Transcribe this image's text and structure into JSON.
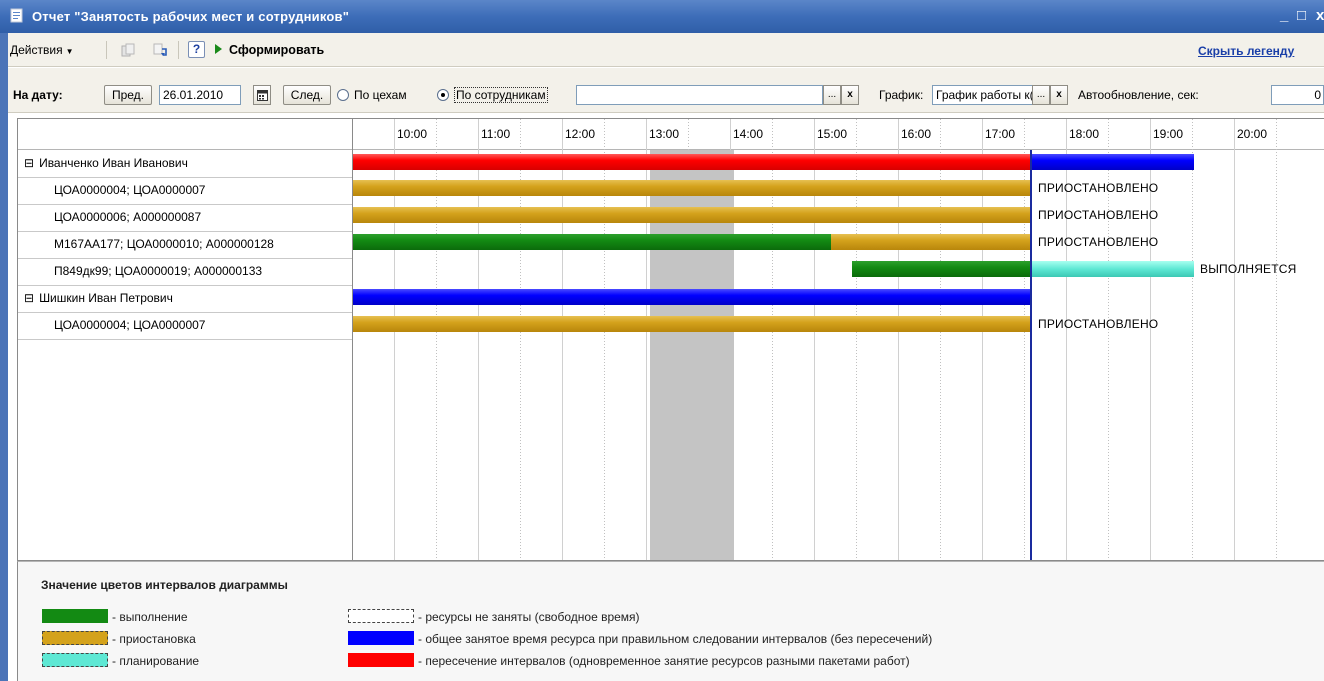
{
  "window": {
    "title": "Отчет  \"Занятость рабочих мест и сотрудников\"",
    "minimize": "_",
    "maximize": "□",
    "close": "x"
  },
  "toolbar": {
    "actions_label": "Действия",
    "help_label": "?",
    "run_label": "Сформировать",
    "hide_legend_label": "Скрыть легенду"
  },
  "filter": {
    "date_label": "На дату:",
    "prev_label": "Пред.",
    "date_value": "26.01.2010",
    "next_label": "След.",
    "radio_shops": "По цехам",
    "radio_employees": "По сотрудникам",
    "employee_value": "",
    "ellipsis": "...",
    "clear": "x",
    "schedule_label": "График:",
    "schedule_value": "График работы к(",
    "autorefresh_label": "Автообновление, сек:",
    "autorefresh_value": "0"
  },
  "timeline": {
    "hours": [
      "10:00",
      "11:00",
      "12:00",
      "13:00",
      "14:00",
      "15:00",
      "16:00",
      "17:00",
      "18:00",
      "19:00",
      "20:00"
    ]
  },
  "rows": [
    {
      "label": "Иванченко Иван Иванович",
      "group": true,
      "status": ""
    },
    {
      "label": "ЦОА0000004; ЦОА0000007",
      "group": false,
      "status": "ПРИОСТАНОВЛЕНО"
    },
    {
      "label": "ЦОА0000006; А000000087",
      "group": false,
      "status": "ПРИОСТАНОВЛЕНО"
    },
    {
      "label": "М167АА177; ЦОА0000010; А000000128",
      "group": false,
      "status": "ПРИОСТАНОВЛЕНО"
    },
    {
      "label": "П849дк99; ЦОА0000019; А000000133",
      "group": false,
      "status": "ВЫПОЛНЯЕТСЯ"
    },
    {
      "label": "Шишкин Иван Петрович",
      "group": true,
      "status": ""
    },
    {
      "label": "ЦОА0000004; ЦОА0000007",
      "group": false,
      "status": "ПРИОСТАНОВЛЕНО"
    }
  ],
  "group_toggle": "⊟",
  "legend": {
    "title": "Значение цветов интервалов диаграммы",
    "items": [
      {
        "text": "- выполнение",
        "color": "#138a13"
      },
      {
        "text": "- приостановка",
        "color": "#d4a21c"
      },
      {
        "text": "- планирование",
        "color": "#5ee8d4"
      },
      {
        "text": "- ресурсы не заняты (свободное время)",
        "color": "#ffffff"
      },
      {
        "text": "- общее занятое время ресурса при правильном следовании интервалов (без пересечений)",
        "color": "#0000ff"
      },
      {
        "text": "- пересечение интервалов (одновременное занятие ресурсов разными пакетами работ)",
        "color": "#ff0000"
      }
    ]
  }
}
